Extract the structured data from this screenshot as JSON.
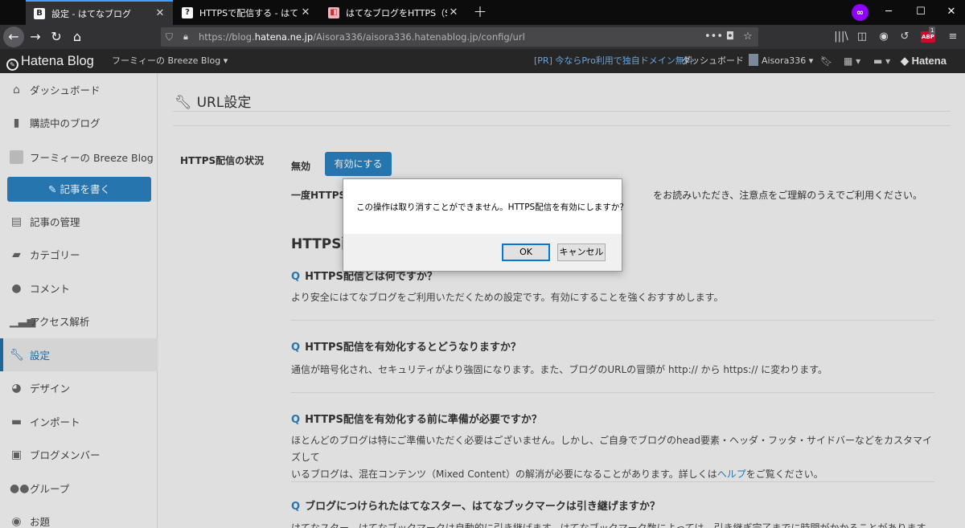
{
  "browser": {
    "tabs": [
      {
        "title": "設定 - はてなブログ",
        "active": true
      },
      {
        "title": "HTTPSで配信する - はてなブログ ヘ",
        "active": false
      },
      {
        "title": "はてなブログをHTTPS（SSL化）す",
        "active": false
      }
    ],
    "url_prefix": "https://blog.",
    "url_host": "hatena.ne.jp",
    "url_path": "/Aisora336/aisora336.hatenablog.jp/config/url",
    "abp_count": "1",
    "accent_color": "#45a1ff"
  },
  "header": {
    "logo": "Hatena Blog",
    "blog_name": "フーミィーの Breeze Blog",
    "pr_link": "[PR] 今ならPro利用で独自ドメイン無料",
    "dashboard": "ダッシュボード",
    "user": "Aisora336",
    "hatena": "Hatena"
  },
  "sidebar": {
    "items": [
      {
        "label": "ダッシュボード",
        "icon": "home-icon"
      },
      {
        "label": "購読中のブログ",
        "icon": "bookmark-icon"
      },
      {
        "label": "フーミィーの Breeze Blog",
        "icon": "blog-thumbnail"
      },
      {
        "label": "記事の管理",
        "icon": "document-icon"
      },
      {
        "label": "カテゴリー",
        "icon": "folder-icon"
      },
      {
        "label": "コメント",
        "icon": "comment-icon"
      },
      {
        "label": "アクセス解析",
        "icon": "bar-chart-icon"
      },
      {
        "label": "設定",
        "icon": "wrench-icon",
        "active": true
      },
      {
        "label": "デザイン",
        "icon": "palette-icon"
      },
      {
        "label": "インポート",
        "icon": "truck-icon"
      },
      {
        "label": "ブログメンバー",
        "icon": "member-card-icon"
      },
      {
        "label": "グループ",
        "icon": "group-icon"
      },
      {
        "label": "お題",
        "icon": "bulb-icon"
      }
    ],
    "write_button": "記事を書く",
    "active_color": "#1f6fa7"
  },
  "main": {
    "title": "URL設定",
    "https_label": "HTTPS配信の状況",
    "status": "無効",
    "enable_button": "有効にする",
    "notice_bold": "一度HTTPS配",
    "notice_rest": "をお読みいただき、注意点をご理解のうえでご利用ください。",
    "section_heading": "HTTPS配",
    "faq": [
      {
        "q": "Q",
        "question": "HTTPS配信とは何ですか？",
        "answer": "より安全にはてなブログをご利用いただくための設定です。有効にすることを強くおすすめします。"
      },
      {
        "q": "Q",
        "question": "HTTPS配信を有効化するとどうなりますか？",
        "answer": "通信が暗号化され、セキュリティがより強固になります。また、ブログのURLの冒頭が http:// から https:// に変わります。"
      },
      {
        "q": "Q",
        "question": "HTTPS配信を有効化する前に準備が必要ですか？",
        "answer_line1": "ほとんどのブログは特にご準備いただく必要はございません。しかし、ご自身でブログのhead要素・ヘッダ・フッタ・サイドバーなどをカスタマイズして",
        "answer_line2_pre": "いるブログは、混在コンテンツ（Mixed Content）の解消が必要になることがあります。詳しくは",
        "answer_link": "ヘルプ",
        "answer_line2_post": "をご覧ください。"
      },
      {
        "q": "Q",
        "question": "ブログにつけられたはてなスター、はてなブックマークは引き継げますか？",
        "answer": "はてなスター、はてなブックマークは自動的に引き継げます。はてなブックマーク数によっては、引き継ぎ完了までに時間がかかることがあります。"
      }
    ],
    "button_color": "#2b7fbe"
  },
  "dialog": {
    "message": "この操作は取り消すことができません。HTTPS配信を有効にしますか？",
    "ok": "OK",
    "cancel": "キャンセル"
  }
}
